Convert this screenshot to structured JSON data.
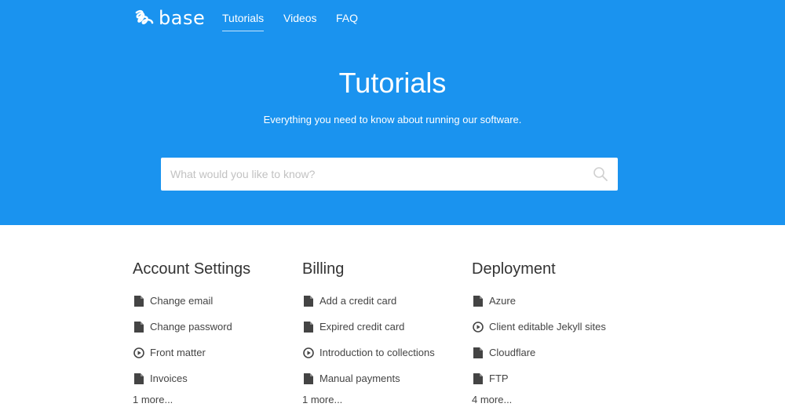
{
  "header": {
    "logo_text": "base",
    "nav": [
      {
        "label": "Tutorials",
        "active": true
      },
      {
        "label": "Videos",
        "active": false
      },
      {
        "label": "FAQ",
        "active": false
      }
    ]
  },
  "hero": {
    "title": "Tutorials",
    "subtitle": "Everything you need to know about running our software.",
    "search_placeholder": "What would you like to know?"
  },
  "colors": {
    "hero_background": "#1a93ef",
    "text": "#333333"
  },
  "categories": [
    {
      "title": "Account Settings",
      "items": [
        {
          "label": "Change email",
          "icon": "document-icon"
        },
        {
          "label": "Change password",
          "icon": "document-icon"
        },
        {
          "label": "Front matter",
          "icon": "play-circle-icon"
        },
        {
          "label": "Invoices",
          "icon": "document-icon"
        }
      ],
      "more": "1 more..."
    },
    {
      "title": "Billing",
      "items": [
        {
          "label": "Add a credit card",
          "icon": "document-icon"
        },
        {
          "label": "Expired credit card",
          "icon": "document-icon"
        },
        {
          "label": "Introduction to collections",
          "icon": "play-circle-icon"
        },
        {
          "label": "Manual payments",
          "icon": "document-icon"
        }
      ],
      "more": "1 more..."
    },
    {
      "title": "Deployment",
      "items": [
        {
          "label": "Azure",
          "icon": "document-icon"
        },
        {
          "label": "Client editable Jekyll sites",
          "icon": "play-circle-icon"
        },
        {
          "label": "Cloudflare",
          "icon": "document-icon"
        },
        {
          "label": "FTP",
          "icon": "document-icon"
        }
      ],
      "more": "4 more..."
    }
  ]
}
